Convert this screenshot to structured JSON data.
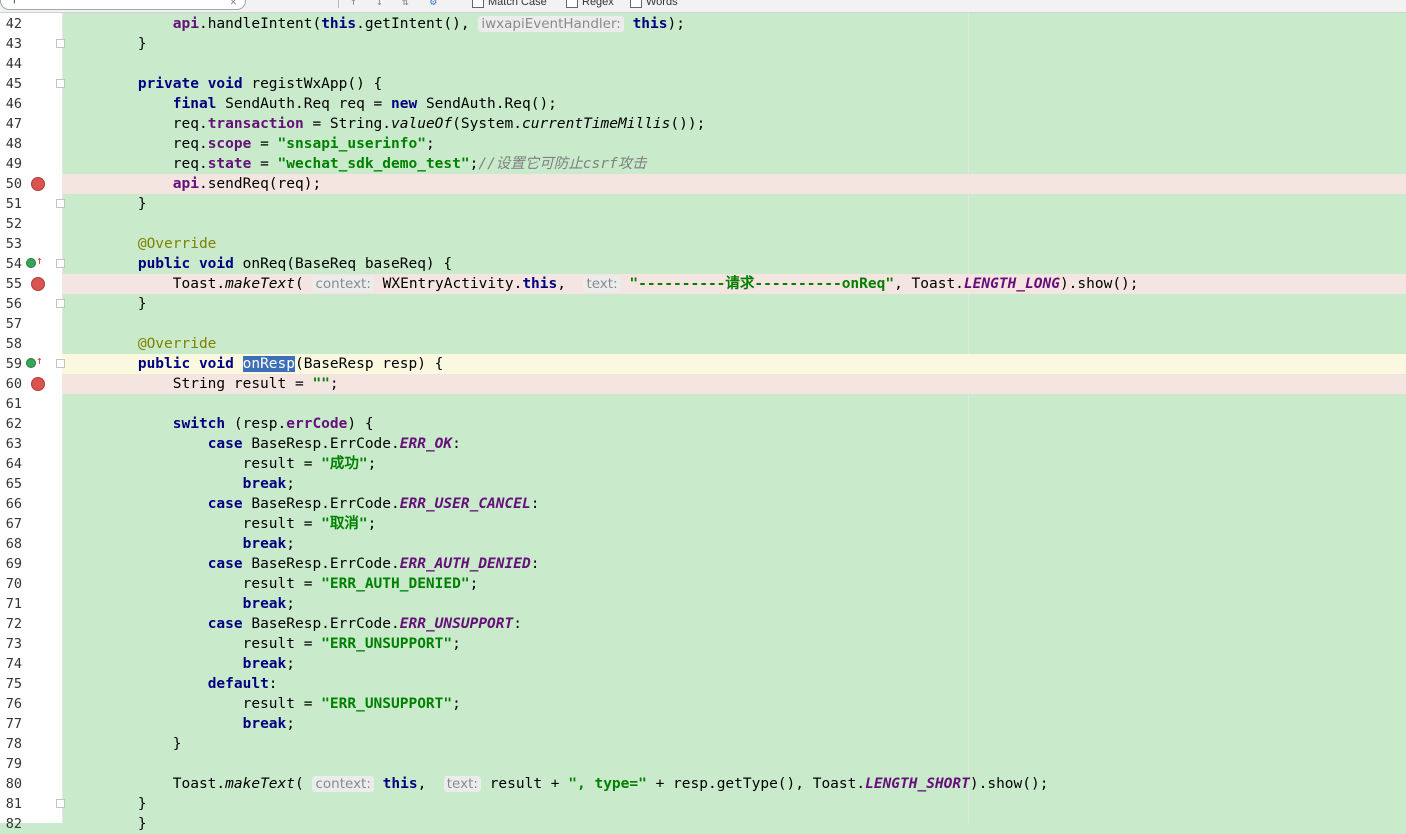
{
  "toolbar": {
    "search_icon": "magnifier-icon",
    "match_case_label": "Match Case",
    "regex_label": "Regex",
    "words_label": "Words"
  },
  "lines": [
    {
      "n": "42",
      "tokens": [
        [
          "    "
        ],
        [
          "api",
          "fld"
        ],
        [
          ".handleIntent("
        ],
        [
          "this",
          "kw"
        ],
        [
          ".getIntent(), "
        ],
        [
          "iwxapiEventHandler:",
          "hint"
        ],
        [
          " "
        ],
        [
          "this",
          "kw"
        ],
        [
          ");"
        ]
      ]
    },
    {
      "n": "43",
      "tokens": [
        [
          "}"
        ]
      ]
    },
    {
      "n": "44",
      "tokens": []
    },
    {
      "n": "45",
      "tokens": [
        [
          "private ",
          "kw"
        ],
        [
          "void ",
          "kw"
        ],
        [
          "registWxApp() {"
        ]
      ]
    },
    {
      "n": "46",
      "tokens": [
        [
          "    "
        ],
        [
          "final ",
          "kw"
        ],
        [
          "SendAuth.Req req = "
        ],
        [
          "new ",
          "kw"
        ],
        [
          "SendAuth.Req();"
        ]
      ]
    },
    {
      "n": "47",
      "tokens": [
        [
          "    req."
        ],
        [
          "transaction",
          "fld"
        ],
        [
          " = String."
        ],
        [
          "valueOf",
          "ital"
        ],
        [
          "(System."
        ],
        [
          "currentTimeMillis",
          "ital"
        ],
        [
          "());"
        ]
      ]
    },
    {
      "n": "48",
      "tokens": [
        [
          "    req."
        ],
        [
          "scope",
          "fld"
        ],
        [
          " = "
        ],
        [
          "\"snsapi_userinfo\"",
          "str"
        ],
        [
          ";"
        ]
      ]
    },
    {
      "n": "49",
      "tokens": [
        [
          "    req."
        ],
        [
          "state",
          "fld"
        ],
        [
          " = "
        ],
        [
          "\"wechat_sdk_demo_test\"",
          "str"
        ],
        [
          ";"
        ],
        [
          "//设置它可防止csrf攻击",
          "cmt"
        ]
      ]
    },
    {
      "n": "50",
      "bp": true,
      "tokens": [
        [
          "    "
        ],
        [
          "api",
          "fld"
        ],
        [
          ".sendReq(req);"
        ]
      ]
    },
    {
      "n": "51",
      "tokens": [
        [
          "}"
        ]
      ]
    },
    {
      "n": "52",
      "tokens": []
    },
    {
      "n": "53",
      "tokens": [
        [
          "@Override",
          "ann"
        ]
      ]
    },
    {
      "n": "54",
      "ovr": true,
      "tokens": [
        [
          "public ",
          "kw"
        ],
        [
          "void ",
          "kw"
        ],
        [
          "onReq(BaseReq baseReq) {"
        ]
      ]
    },
    {
      "n": "55",
      "bp": true,
      "tokens": [
        [
          "    Toast."
        ],
        [
          "makeText",
          "ital"
        ],
        [
          "( "
        ],
        [
          "context:",
          "hint"
        ],
        [
          " WXEntryActivity."
        ],
        [
          "this",
          "kw"
        ],
        [
          ",  "
        ],
        [
          "text:",
          "hint"
        ],
        [
          " "
        ],
        [
          "\"----------请求----------onReq\"",
          "str"
        ],
        [
          ", Toast."
        ],
        [
          "LENGTH_LONG",
          "const"
        ],
        [
          ").show();"
        ]
      ]
    },
    {
      "n": "56",
      "tokens": [
        [
          "}"
        ]
      ]
    },
    {
      "n": "57",
      "tokens": []
    },
    {
      "n": "58",
      "tokens": [
        [
          "@Override",
          "ann"
        ]
      ]
    },
    {
      "n": "59",
      "ovr": true,
      "caret": true,
      "tokens": [
        [
          "public ",
          "kw"
        ],
        [
          "void ",
          "kw"
        ],
        [
          "onResp",
          "sel"
        ],
        [
          "(BaseResp resp) {"
        ]
      ]
    },
    {
      "n": "60",
      "bp": true,
      "tokens": [
        [
          "    String result = "
        ],
        [
          "\"\"",
          "str"
        ],
        [
          ";"
        ]
      ]
    },
    {
      "n": "61",
      "tokens": []
    },
    {
      "n": "62",
      "tokens": [
        [
          "    "
        ],
        [
          "switch ",
          "kw"
        ],
        [
          "(resp."
        ],
        [
          "errCode",
          "fld"
        ],
        [
          ") {"
        ]
      ]
    },
    {
      "n": "63",
      "tokens": [
        [
          "        "
        ],
        [
          "case ",
          "kw"
        ],
        [
          "BaseResp.ErrCode."
        ],
        [
          "ERR_OK",
          "const"
        ],
        [
          ":"
        ]
      ]
    },
    {
      "n": "64",
      "tokens": [
        [
          "            result = "
        ],
        [
          "\"成功\"",
          "str"
        ],
        [
          ";"
        ]
      ]
    },
    {
      "n": "65",
      "tokens": [
        [
          "            "
        ],
        [
          "break",
          "kw"
        ],
        [
          ";"
        ]
      ]
    },
    {
      "n": "66",
      "tokens": [
        [
          "        "
        ],
        [
          "case ",
          "kw"
        ],
        [
          "BaseResp.ErrCode."
        ],
        [
          "ERR_USER_CANCEL",
          "const"
        ],
        [
          ":"
        ]
      ]
    },
    {
      "n": "67",
      "tokens": [
        [
          "            result = "
        ],
        [
          "\"取消\"",
          "str"
        ],
        [
          ";"
        ]
      ]
    },
    {
      "n": "68",
      "tokens": [
        [
          "            "
        ],
        [
          "break",
          "kw"
        ],
        [
          ";"
        ]
      ]
    },
    {
      "n": "69",
      "tokens": [
        [
          "        "
        ],
        [
          "case ",
          "kw"
        ],
        [
          "BaseResp.ErrCode."
        ],
        [
          "ERR_AUTH_DENIED",
          "const"
        ],
        [
          ":"
        ]
      ]
    },
    {
      "n": "70",
      "tokens": [
        [
          "            result = "
        ],
        [
          "\"ERR_AUTH_DENIED\"",
          "str"
        ],
        [
          ";"
        ]
      ]
    },
    {
      "n": "71",
      "tokens": [
        [
          "            "
        ],
        [
          "break",
          "kw"
        ],
        [
          ";"
        ]
      ]
    },
    {
      "n": "72",
      "tokens": [
        [
          "        "
        ],
        [
          "case ",
          "kw"
        ],
        [
          "BaseResp.ErrCode."
        ],
        [
          "ERR_UNSUPPORT",
          "const"
        ],
        [
          ":"
        ]
      ]
    },
    {
      "n": "73",
      "tokens": [
        [
          "            result = "
        ],
        [
          "\"ERR_UNSUPPORT\"",
          "str"
        ],
        [
          ";"
        ]
      ]
    },
    {
      "n": "74",
      "tokens": [
        [
          "            "
        ],
        [
          "break",
          "kw"
        ],
        [
          ";"
        ]
      ]
    },
    {
      "n": "75",
      "tokens": [
        [
          "        "
        ],
        [
          "default",
          "kw"
        ],
        [
          ":"
        ]
      ]
    },
    {
      "n": "76",
      "tokens": [
        [
          "            result = "
        ],
        [
          "\"ERR_UNSUPPORT\"",
          "str"
        ],
        [
          ";"
        ]
      ]
    },
    {
      "n": "77",
      "tokens": [
        [
          "            "
        ],
        [
          "break",
          "kw"
        ],
        [
          ";"
        ]
      ]
    },
    {
      "n": "78",
      "tokens": [
        [
          "    }"
        ]
      ]
    },
    {
      "n": "79",
      "tokens": []
    },
    {
      "n": "80",
      "tokens": [
        [
          "    Toast."
        ],
        [
          "makeText",
          "ital"
        ],
        [
          "( "
        ],
        [
          "context:",
          "hint"
        ],
        [
          " "
        ],
        [
          "this",
          "kw"
        ],
        [
          ",  "
        ],
        [
          "text:",
          "hint"
        ],
        [
          " result + "
        ],
        [
          "\", type=\"",
          "str"
        ],
        [
          " + resp.getType(), Toast."
        ],
        [
          "LENGTH_SHORT",
          "const"
        ],
        [
          ").show();"
        ]
      ]
    },
    {
      "n": "81",
      "tokens": [
        [
          "}"
        ]
      ]
    },
    {
      "n": "82",
      "tokens": [
        [
          "}"
        ]
      ]
    }
  ]
}
